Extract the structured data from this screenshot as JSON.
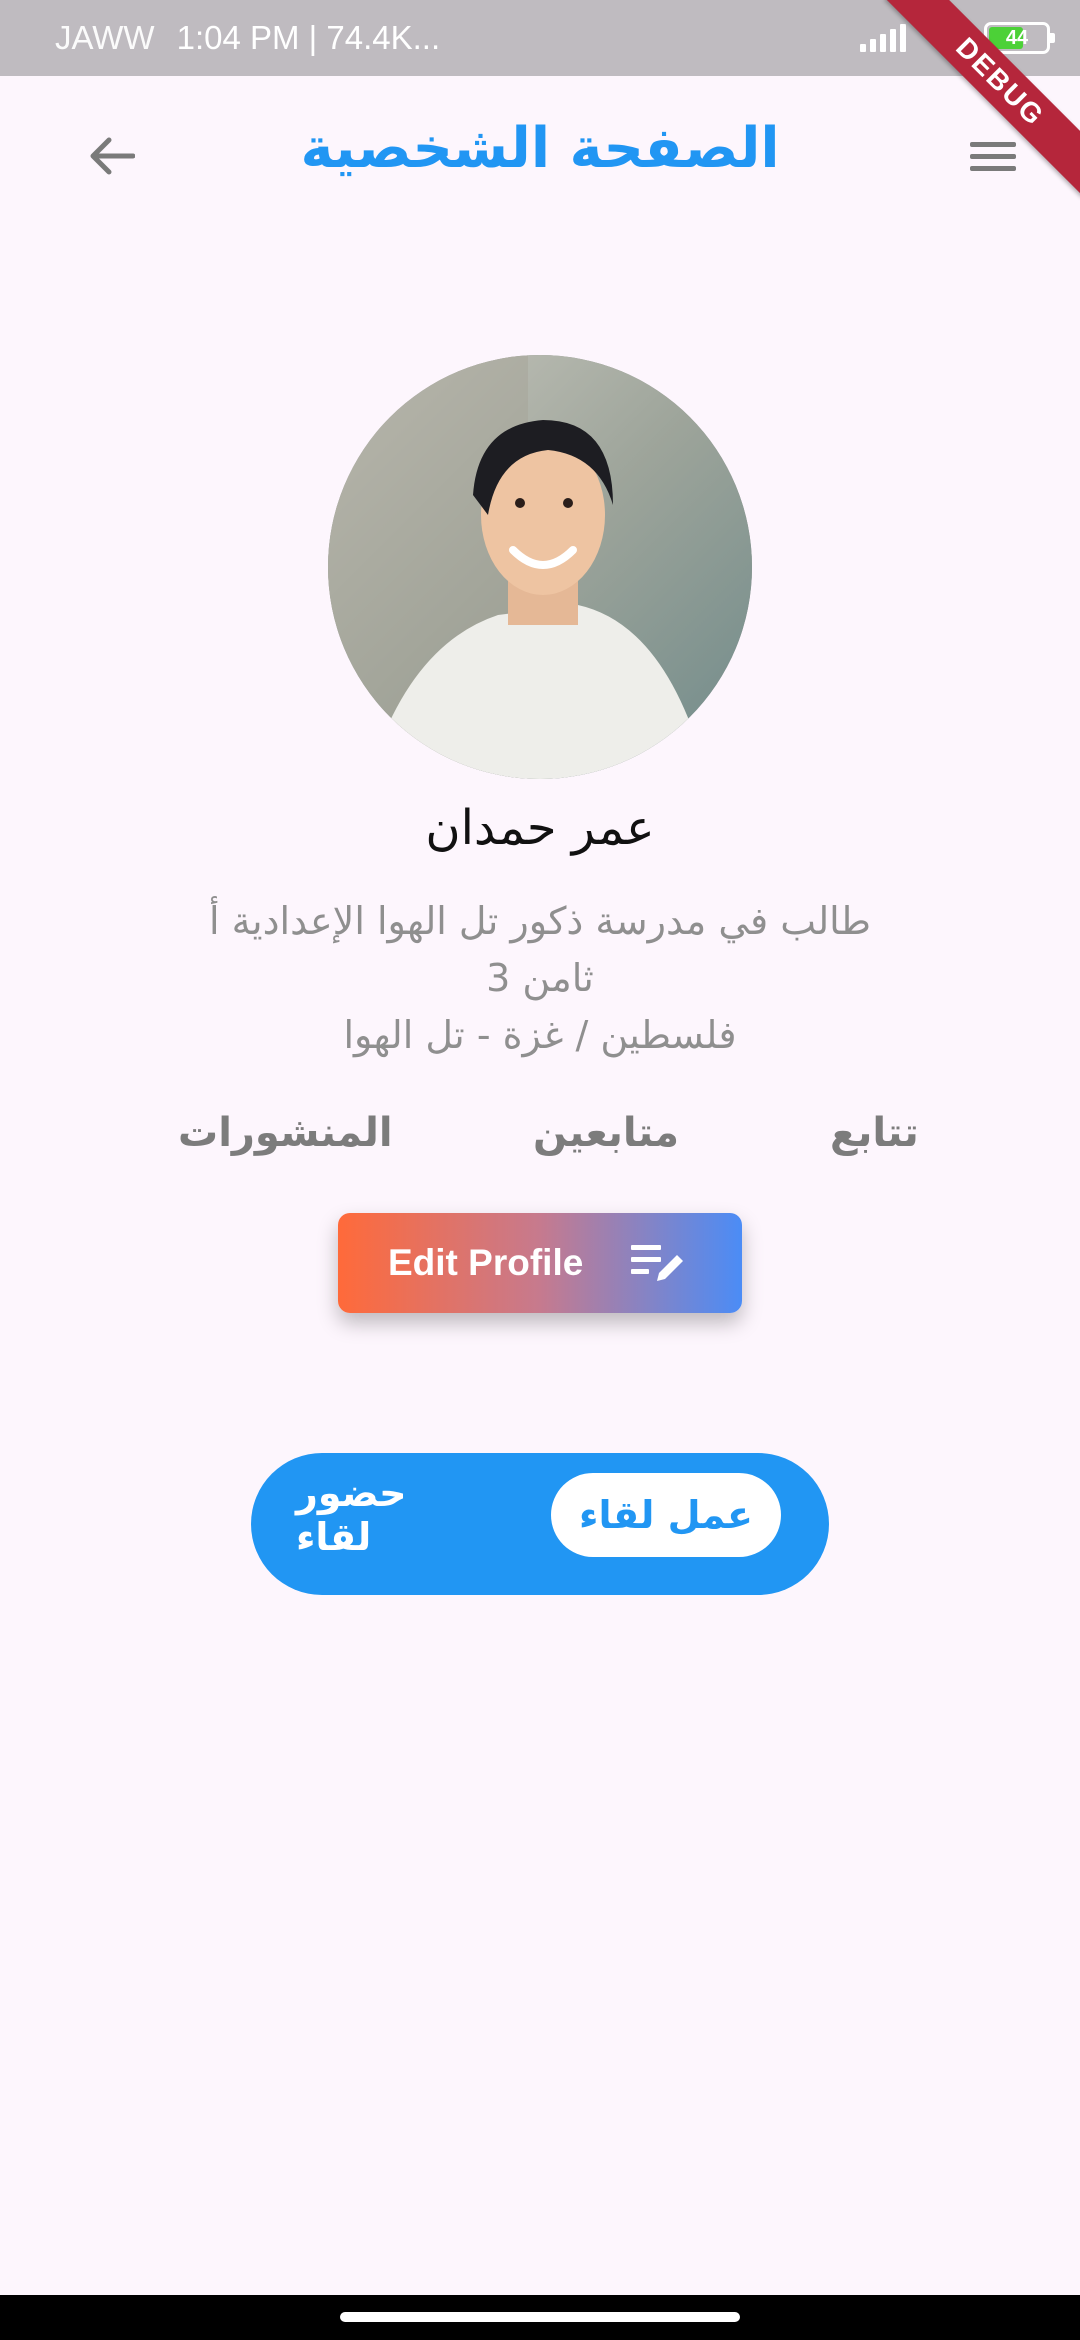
{
  "status_bar": {
    "carrier": "JAWW",
    "time_info": "1:04 PM | 74.4K...",
    "battery": "44"
  },
  "debug_banner": "DEBUG",
  "app_bar": {
    "title": "الصفحة الشخصية",
    "back_icon": "arrow-back-icon",
    "menu_icon": "menu-icon"
  },
  "profile": {
    "name": "عمر حمدان",
    "bio_line1": "طالب في مدرسة ذكور تل الهوا الإعدادية أ",
    "bio_line2": "ثامن 3",
    "bio_line3": "فلسطين / غزة - تل الهوا"
  },
  "stats": {
    "posts": "المنشورات",
    "followers": "متابعين",
    "following": "تتابع"
  },
  "edit_button": {
    "label": "Edit Profile",
    "icon": "edit-note-icon"
  },
  "meeting_toggle": {
    "active_label": "عمل لقاء",
    "inactive_label": "حضور لقاء"
  },
  "colors": {
    "accent": "#2196f3",
    "background": "#fdf6fd",
    "gradient_start": "#ff6a3a",
    "gradient_end": "#4b8cf6"
  }
}
